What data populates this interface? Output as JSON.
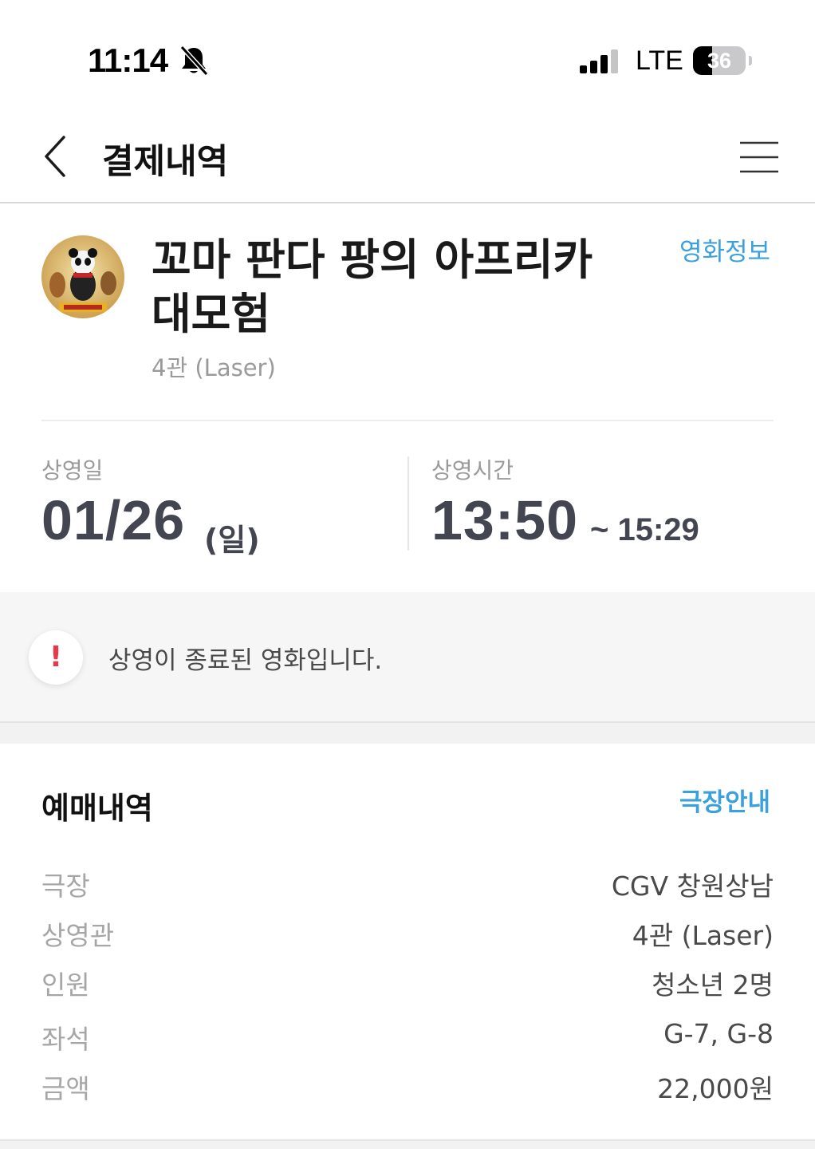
{
  "status_bar": {
    "time": "11:14",
    "network": "LTE",
    "battery_level": "36",
    "battery_fraction": 0.36,
    "icons": [
      "bell-slash-icon",
      "signal-icon",
      "battery-icon"
    ]
  },
  "header": {
    "title": "결제내역",
    "back_icon": "chevron-left-icon",
    "menu_icon": "hamburger-icon"
  },
  "movie": {
    "title": "꼬마 판다 팡의 아프리카 대모험",
    "screen": "4관 (Laser)",
    "info_link": "영화정보",
    "poster_icon": "movie-poster"
  },
  "schedule": {
    "date_label": "상영일",
    "date": "01/26",
    "day": "(일)",
    "time_label": "상영시간",
    "start": "13:50",
    "end": "~ 15:29"
  },
  "notice": {
    "icon": "alert-icon",
    "symbol": "!",
    "text": "상영이 종료된 영화입니다."
  },
  "booking": {
    "title": "예매내역",
    "theater_link": "극장안내",
    "rows": [
      {
        "label": "극장",
        "value": "CGV 창원상남"
      },
      {
        "label": "상영관",
        "value": "4관 (Laser)"
      },
      {
        "label": "인원",
        "value": "청소년 2명"
      },
      {
        "label": "좌석",
        "value": "G-7, G-8"
      },
      {
        "label": "금액",
        "value": "22,000원"
      }
    ]
  },
  "colors": {
    "accent": "#3aa0de",
    "alert": "#e8394a",
    "value_text": "#434651"
  }
}
